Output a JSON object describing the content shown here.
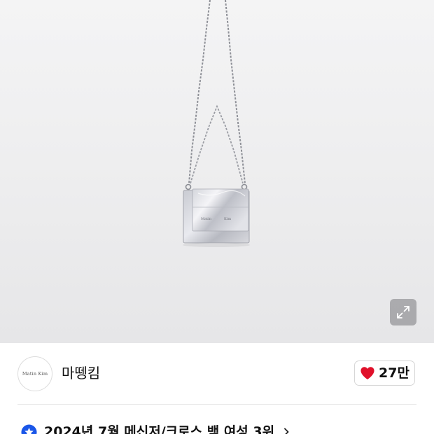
{
  "product": {
    "image_alt": "Matin Kim silver mini chain bag",
    "bag_emboss_left": "Matin",
    "bag_emboss_right": "Kim",
    "expand_icon": "expand-arrows-icon"
  },
  "brand": {
    "logo_text": "Matin   Kim",
    "name": "마뗑킴",
    "like_icon": "heart-icon",
    "like_color": "#e0102a",
    "like_count": "27만"
  },
  "ranking": {
    "icon": "star-badge-icon",
    "icon_color": "#1a56e8",
    "text": "2024년 7월 메신저/크로스 백 여성 3위",
    "chevron_icon": "chevron-right-icon"
  }
}
